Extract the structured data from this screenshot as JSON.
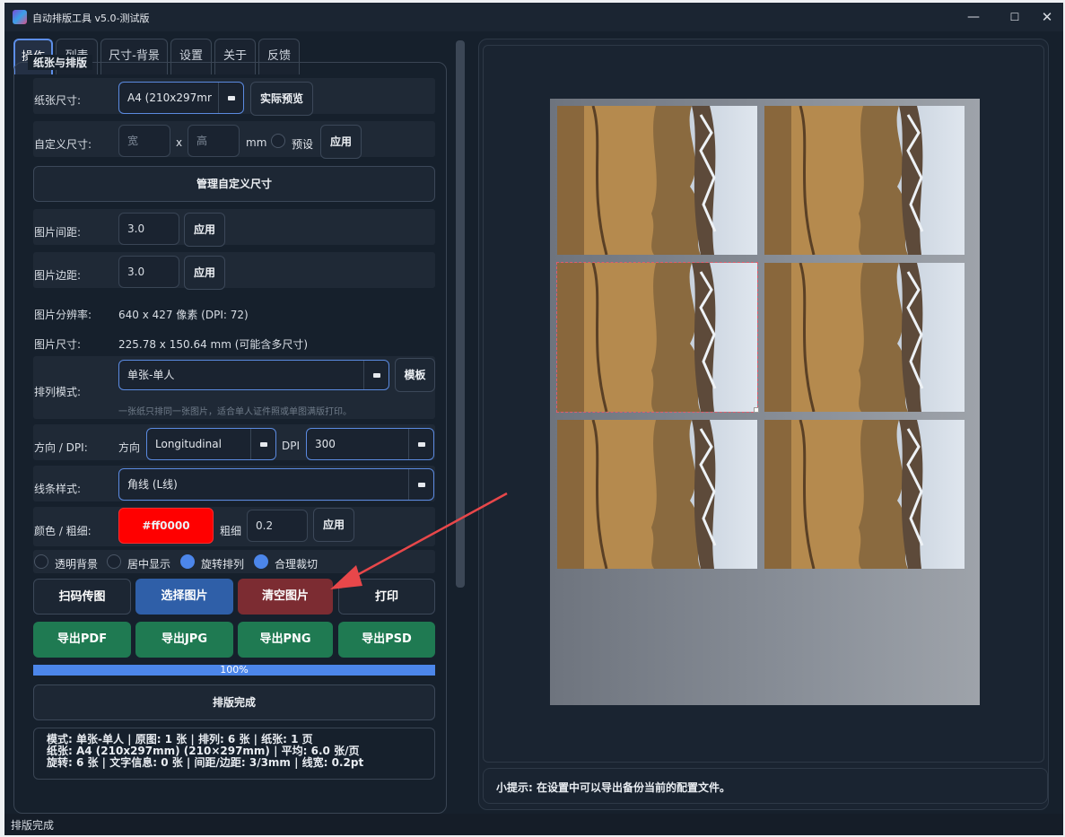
{
  "window": {
    "title": "自动排版工具 v5.0-测试版",
    "min": "—",
    "max": "☐",
    "close": "✕"
  },
  "tabs": [
    "操作",
    "列表",
    "尺寸-背景",
    "设置",
    "关于",
    "反馈"
  ],
  "group_title": "纸张与排版",
  "paper_size": {
    "label": "纸张尺寸:",
    "value": "A4 (210x297mr",
    "preview_button": "实际预览"
  },
  "custom_size": {
    "label": "自定义尺寸:",
    "width_placeholder": "宽",
    "x": "x",
    "height_placeholder": "高",
    "unit": "mm",
    "preset": "预设",
    "apply": "应用"
  },
  "manage_button": "管理自定义尺寸",
  "spacing": {
    "label": "图片间距:",
    "value": "3.0",
    "apply": "应用"
  },
  "margin": {
    "label": "图片边距:",
    "value": "3.0",
    "apply": "应用"
  },
  "resolution": {
    "label": "图片分辨率:",
    "value": "640 x 427 像素 (DPI: 72)"
  },
  "image_size": {
    "label": "图片尺寸:",
    "value": "225.78 x 150.64 mm (可能含多尺寸)"
  },
  "layout_mode": {
    "label": "排列模式:",
    "value": "单张-单人",
    "template": "模板",
    "hint": "一张纸只排同一张图片，适合单人证件照或单图满版打印。"
  },
  "orientation": {
    "label": "方向 / DPI:",
    "dir_label": "方向",
    "dir_value": "Longitudinal",
    "dpi_label": "DPI",
    "dpi_value": "300"
  },
  "line_style": {
    "label": "线条样式:",
    "value": "角线 (L线)"
  },
  "color": {
    "label": "颜色 / 粗细:",
    "value": "#ff0000",
    "weight_label": "粗细",
    "weight_value": "0.2",
    "apply": "应用",
    "swatch": "#ff0000"
  },
  "options": [
    {
      "label": "透明背景",
      "checked": false
    },
    {
      "label": "居中显示",
      "checked": false
    },
    {
      "label": "旋转排列",
      "checked": true
    },
    {
      "label": "合理裁切",
      "checked": true
    }
  ],
  "actions": {
    "scan": "扫码传图",
    "select": "选择图片",
    "clear": "清空图片",
    "print": "打印"
  },
  "exports": {
    "pdf": "导出PDF",
    "jpg": "导出JPG",
    "png": "导出PNG",
    "psd": "导出PSD"
  },
  "progress": {
    "value": 1.0,
    "text": "100%"
  },
  "done_button": "排版完成",
  "summary": {
    "line1": "模式: 单张-单人 | 原图: 1 张 | 排列: 6 张 | 纸张: 1 页",
    "line2": "纸张: A4 (210x297mm) (210×297mm)  | 平均: 6.0 张/页",
    "line3": "旋转: 6 张 | 文字信息: 0 张 | 间距/边距: 3/3mm | 线宽: 0.2pt"
  },
  "tip": "小提示: 在设置中可以导出备份当前的配置文件。",
  "status": "排版完成",
  "colors": {
    "accent": "#4c86ea",
    "red_button": "#7c2c32",
    "green_button": "#1f7a52",
    "blue_button": "#2f5fa8",
    "annotation_arrow": "#e8474a"
  }
}
